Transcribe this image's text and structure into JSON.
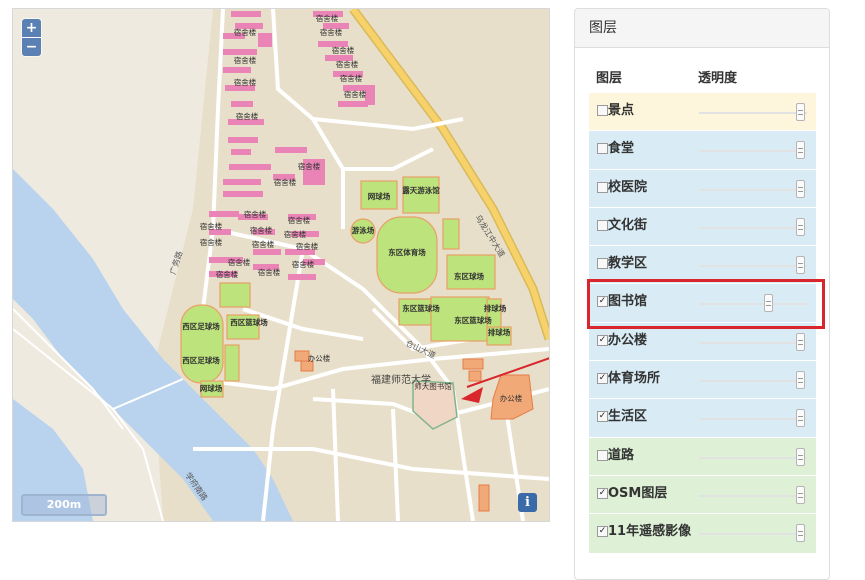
{
  "map": {
    "zoom_in": "+",
    "zoom_out": "−",
    "scale_label": "200m",
    "info_label": "i",
    "labels": {
      "dorm": "宿舍楼",
      "road_main": "乌龙江中大道",
      "road_guangfu": "广务路",
      "road_xuefu": "学府南路",
      "road_cangshan": "仓山大道",
      "tennis": "网球场",
      "pool_open": "露天游泳馆",
      "pool": "游泳场",
      "gym": "东区体育场",
      "basketball_e1": "东区球场",
      "basketball_e2": "东区篮球场",
      "basketball_e3": "东区篮球场",
      "volleyball1": "排球场",
      "volleyball2": "排球场",
      "football_w": "西区足球场",
      "basketball_w": "西区篮球场",
      "football_w2": "西区足球场",
      "tennis_w": "网球场",
      "office1": "办公楼",
      "office2": "办公楼",
      "university": "福建师范大学",
      "library": "师大图书馆"
    }
  },
  "panel": {
    "title": "图层",
    "col_layer": "图层",
    "col_opacity": "透明度",
    "colors": {
      "tan": "#fdf6dc",
      "blue": "#d9ecf5",
      "green": "#def0d6",
      "highlight": "#d9262c"
    },
    "layers": [
      {
        "name": "景点",
        "checked": false,
        "bg": "tan",
        "opacity": 1.0
      },
      {
        "name": "食堂",
        "checked": false,
        "bg": "blue",
        "opacity": 1.0
      },
      {
        "name": "校医院",
        "checked": false,
        "bg": "blue",
        "opacity": 1.0
      },
      {
        "name": "文化街",
        "checked": false,
        "bg": "blue",
        "opacity": 1.0
      },
      {
        "name": "教学区",
        "checked": false,
        "bg": "blue",
        "opacity": 1.0
      },
      {
        "name": "图书馆",
        "checked": true,
        "bg": "blue",
        "opacity": 0.68
      },
      {
        "name": "办公楼",
        "checked": true,
        "bg": "blue",
        "opacity": 1.0
      },
      {
        "name": "体育场所",
        "checked": true,
        "bg": "blue",
        "opacity": 1.0
      },
      {
        "name": "生活区",
        "checked": true,
        "bg": "blue",
        "opacity": 1.0
      },
      {
        "name": "道路",
        "checked": false,
        "bg": "green",
        "opacity": 1.0
      },
      {
        "name": "OSM图层",
        "checked": true,
        "bg": "green",
        "opacity": 1.0
      },
      {
        "name": "11年遥感影像",
        "checked": true,
        "bg": "green",
        "opacity": 1.0
      }
    ]
  }
}
